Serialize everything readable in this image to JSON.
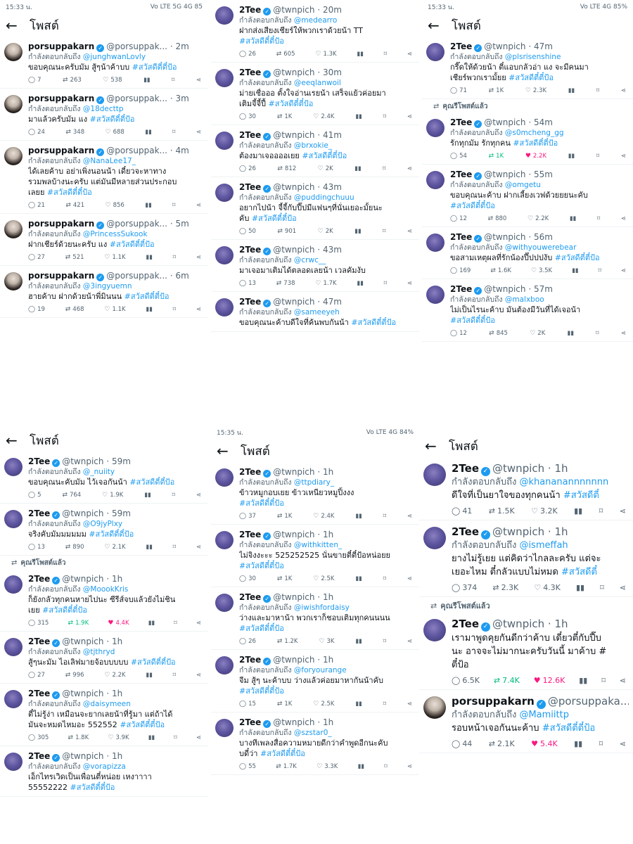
{
  "panels": [
    {
      "status": {
        "time": "15:33 น.",
        "right": "Vo LTE 5G 4G 85"
      },
      "title": "โพสต์",
      "tweets": [
        {
          "name": "porsuppakarn",
          "handle": "@porsuppak...",
          "time": "· 2m",
          "replying_to_label": "กำลังตอบกลับถึง",
          "mention": "@junghwanLovly",
          "text": "ขอบคุณนะครับมัม สู้ๆน้าค้าบบ ",
          "hashtag": "#สวัสดีตี๋ตี๋ป้อ",
          "replies": "7",
          "retweets": "263",
          "likes": "538",
          "views": "",
          "avatar": "porsuppakarn-avatar"
        },
        {
          "name": "porsuppakarn",
          "handle": "@porsuppak...",
          "time": "· 3m",
          "replying_to_label": "กำลังตอบกลับถึง",
          "mention": "@18decttp",
          "text": "มาแล้วครับมัม แง ",
          "hashtag": "#สวัสดีตี๋ตี๋ป้อ",
          "replies": "24",
          "retweets": "348",
          "likes": "688",
          "views": "",
          "avatar": "porsuppakarn-avatar"
        },
        {
          "name": "porsuppakarn",
          "handle": "@porsuppak...",
          "time": "· 4m",
          "replying_to_label": "กำลังตอบกลับถึง",
          "mention": "@NanaLee17_",
          "text": "ได้เลยค้าบ อย่าเพิ่งนอนน้า เดี๋ยวจะหาทาง\nรวมพลบ้างนะครับ แต่มันมีหลายส่วนประกอบ\nเลยย ",
          "hashtag": "#สวัสดีตี๋ตี๋ป้อ",
          "replies": "21",
          "retweets": "421",
          "likes": "856",
          "views": "",
          "avatar": "porsuppakarn-avatar"
        },
        {
          "name": "porsuppakarn",
          "handle": "@porsuppak...",
          "time": "· 5m",
          "replying_to_label": "กำลังตอบกลับถึง",
          "mention": "@PrincessSukook",
          "text": "ฝากเชียร์ด้วยนะครับ แง ",
          "hashtag": "#สวัสดีตี๋ตี๋ป้อ",
          "replies": "27",
          "retweets": "521",
          "likes": "1.1K",
          "views": "",
          "avatar": "porsuppakarn-avatar"
        },
        {
          "name": "porsuppakarn",
          "handle": "@porsuppak...",
          "time": "· 6m",
          "replying_to_label": "กำลังตอบกลับถึง",
          "mention": "@3ingyuemn",
          "text": "ฮายค้าบ ฝากด้วยน้าพี่มินนน ",
          "hashtag": "#สวัสดีตี๋ตี๋ป้อ",
          "replies": "19",
          "retweets": "468",
          "likes": "1.1K",
          "views": "",
          "avatar": "porsuppakarn-avatar"
        }
      ]
    },
    {
      "status": null,
      "title": "",
      "tweets": [
        {
          "name": "2Tee",
          "handle": "@twnpich",
          "time": "· 20m",
          "replying_to_label": "กำลังตอบกลับถึง",
          "mention": "@medearro",
          "text": "ฝากส่งเสียงเชียร์ให้พวกเราด้วยน้า TT\n",
          "hashtag": "#สวัสดีตี๋ตี๋ป้อ",
          "replies": "26",
          "retweets": "605",
          "likes": "1.3K",
          "views": "",
          "avatar": "2tee-avatar"
        },
        {
          "name": "2Tee",
          "handle": "@twnpich",
          "time": "· 30m",
          "replying_to_label": "กำลังตอบกลับถึง",
          "mention": "@eeqlanwoil",
          "text": "ม่ายเชื่อออ ตั้งใจอ่านเรยน้า เสร็จแย้วค่อยมา\nเติมจี้จี้ปี้ ",
          "hashtag": "#สวัสดีตี๋ตี๋ป้อ",
          "replies": "30",
          "retweets": "1K",
          "likes": "2.4K",
          "views": "",
          "avatar": "2tee-avatar"
        },
        {
          "name": "2Tee",
          "handle": "@twnpich",
          "time": "· 41m",
          "replying_to_label": "กำลังตอบกลับถึง",
          "mention": "@brxokie_",
          "text": "ต้องมาเจออออเยย ",
          "hashtag": "#สวัสดีตี๋ตี๋ป้อ",
          "replies": "26",
          "retweets": "812",
          "likes": "2K",
          "views": "",
          "avatar": "2tee-avatar"
        },
        {
          "name": "2Tee",
          "handle": "@twnpich",
          "time": "· 43m",
          "replying_to_label": "กำลังตอบกลับถึง",
          "mention": "@puddingchuuu",
          "text": "อยากไปน้า จี้จี้กับปี๊ปมีแฟนๆที่นั่นเยอะมั้ยนะ\nคับ ",
          "hashtag": "#สวัสดีตี๋ตี๋ป้อ",
          "replies": "50",
          "retweets": "901",
          "likes": "2K",
          "views": "",
          "avatar": "2tee-avatar"
        },
        {
          "name": "2Tee",
          "handle": "@twnpich",
          "time": "· 43m",
          "replying_to_label": "กำลังตอบกลับถึง",
          "mention": "@crwc__",
          "text": "มาเจอมาเติมได้ตลอดเลยน้า เวลคัมงับ",
          "hashtag": "",
          "replies": "13",
          "retweets": "738",
          "likes": "1.7K",
          "views": "",
          "avatar": "2tee-avatar"
        },
        {
          "name": "2Tee",
          "handle": "@twnpich",
          "time": "· 47m",
          "replying_to_label": "กำลังตอบกลับถึง",
          "mention": "@sameeyeh",
          "text": "ขอบคุณนะค้าบดีใจที่ค้นพบกันน้า ",
          "hashtag": "#สวัสดีตี๋ตี๋ป้อ",
          "replies": "",
          "retweets": "",
          "likes": "",
          "views": "",
          "avatar": "2tee-avatar"
        }
      ]
    },
    {
      "status": {
        "time": "15:33 น.",
        "right": "Vo LTE 4G 85%"
      },
      "title": "โพสต์",
      "tweets": [
        {
          "name": "2Tee",
          "handle": "@twnpich",
          "time": "· 47m",
          "replying_to_label": "กำลังตอบกลับถึง",
          "mention": "@plsrisenshine",
          "text": "กรี๊ดให้ด้วยน้า ตี๋แอบกลัวอ่า แง จะมีคนมา\nเชียร์พวกเรามั้ยย ",
          "hashtag": "#สวัสดีตี๋ตี๋ป้อ",
          "replies": "71",
          "retweets": "1K",
          "likes": "2.3K",
          "views": "",
          "avatar": "2tee-avatar"
        },
        {
          "retweet_label": "คุณรีโพสต์แล้ว",
          "name": "2Tee",
          "handle": "@twnpich",
          "time": "· 54m",
          "replying_to_label": "กำลังตอบกลับถึง",
          "mention": "@s0mcheng_gg",
          "text": "รักทุกมัม รักทุกคน ",
          "hashtag": "#สวัสดีตี๋ตี๋ป้อ",
          "replies": "54",
          "retweets": "1K",
          "likes": "2.2K",
          "views": "",
          "rt_on": true,
          "lk_on": true,
          "avatar": "2tee-avatar"
        },
        {
          "name": "2Tee",
          "handle": "@twnpich",
          "time": "· 55m",
          "replying_to_label": "กำลังตอบกลับถึง",
          "mention": "@omgetu",
          "text": "ขอบคุณนะค้าบ ฝากเลี้ยงเวฟด้วยยยนะคับ\n",
          "hashtag": "#สวัสดีตี๋ตี๋ป้อ",
          "replies": "12",
          "retweets": "880",
          "likes": "2.2K",
          "views": "",
          "avatar": "2tee-avatar"
        },
        {
          "name": "2Tee",
          "handle": "@twnpich",
          "time": "· 56m",
          "replying_to_label": "กำลังตอบกลับถึง",
          "mention": "@withyouwerebear",
          "text": "ขอสามเหตุผลที่รักน้องปี๊ปปปงับ ",
          "hashtag": "#สวัสดีตี๋ตี๋ป้อ",
          "replies": "169",
          "retweets": "1.6K",
          "likes": "3.5K",
          "views": "",
          "avatar": "2tee-avatar"
        },
        {
          "name": "2Tee",
          "handle": "@twnpich",
          "time": "· 57m",
          "replying_to_label": "กำลังตอบกลับถึง",
          "mention": "@malxboo",
          "text": "ไม่เป็นไรนะค้าบ มันต้องมีวันที่ได้เจอน้า\n",
          "hashtag": "#สวัสดีตี๋ตี๋ป้อ",
          "replies": "12",
          "retweets": "845",
          "likes": "2K",
          "views": "",
          "avatar": "2tee-avatar"
        }
      ]
    },
    {
      "status": null,
      "title": "โพสต์",
      "tweets": [
        {
          "name": "2Tee",
          "handle": "@twnpich",
          "time": "· 59m",
          "replying_to_label": "กำลังตอบกลับถึง",
          "mention": "@_nuiity",
          "text": "ขอบคุณนะคับมัม ไว้เจอกันน้า ",
          "hashtag": "#สวัสดีตี๋ตี๋ป้อ",
          "replies": "5",
          "retweets": "764",
          "likes": "1.9K",
          "views": "",
          "avatar": "2tee-avatar"
        },
        {
          "name": "2Tee",
          "handle": "@twnpich",
          "time": "· 59m",
          "replying_to_label": "กำลังตอบกลับถึง",
          "mention": "@O9jyPlxy",
          "text": "จริงคับมัมมมมมม ",
          "hashtag": "#สวัสดีตี๋ตี๋ป้อ",
          "replies": "13",
          "retweets": "890",
          "likes": "2.1K",
          "views": "",
          "avatar": "2tee-avatar"
        },
        {
          "retweet_label": "คุณรีโพสต์แล้ว",
          "name": "2Tee",
          "handle": "@twnpich",
          "time": "· 1h",
          "replying_to_label": "กำลังตอบกลับถึง",
          "mention": "@MoookKris",
          "text": "ก็ยังกลัวทุกคนหายไปนะ ซีรีส์จบแล้วยังไม่ชิน\nเยย ",
          "hashtag": "#สวัสดีตี๋ตี๋ป้อ",
          "replies": "315",
          "retweets": "1.9K",
          "likes": "4.4K",
          "views": "",
          "rt_on": true,
          "lk_on": true,
          "avatar": "2tee-avatar"
        },
        {
          "name": "2Tee",
          "handle": "@twnpich",
          "time": "· 1h",
          "replying_to_label": "กำลังตอบกลับถึง",
          "mention": "@tjthryd",
          "text": "สู้ๆนะมัม ไอเลิฟมายจ้อบบบบบ ",
          "hashtag": "#สวัสดีตี๋ตี๋ป้อ",
          "replies": "27",
          "retweets": "996",
          "likes": "2.2K",
          "views": "",
          "avatar": "2tee-avatar"
        },
        {
          "name": "2Tee",
          "handle": "@twnpich",
          "time": "· 1h",
          "replying_to_label": "กำลังตอบกลับถึง",
          "mention": "@daisymeen",
          "text": "ตี๋ไม่รู้ง่า เหมือนจะยากเลยน้าที่รู้มา แต่ถ้าได้\nมันจะหมดไหมอะ 552552 ",
          "hashtag": "#สวัสดีตี๋ตี๋ป้อ",
          "replies": "305",
          "retweets": "1.8K",
          "likes": "3.9K",
          "views": "",
          "avatar": "2tee-avatar"
        },
        {
          "name": "2Tee",
          "handle": "@twnpich",
          "time": "· 1h",
          "replying_to_label": "กำลังตอบกลับถึง",
          "mention": "@vorapizza",
          "text": "เอ็กไทรเวิดเป็นเพื่อนตี๋หน่อย เหงาาาา\n55552222 ",
          "hashtag": "#สวัสดีตี๋ตี๋ป้อ",
          "replies": "",
          "retweets": "",
          "likes": "",
          "views": "",
          "avatar": "2tee-avatar"
        }
      ]
    },
    {
      "status": {
        "time": "15:35 น.",
        "right": "Vo LTE 4G 84%"
      },
      "title": "โพสต์",
      "tweets": [
        {
          "name": "2Tee",
          "handle": "@twnpich",
          "time": "· 1h",
          "replying_to_label": "กำลังตอบกลับถึง",
          "mention": "@ttpdiary_",
          "text": "ข้าวหมูกอบเยย ข้าวเหนียวหมูปิ้งงง\n",
          "hashtag": "#สวัสดีตี๋ตี๋ป้อ",
          "replies": "37",
          "retweets": "1K",
          "likes": "2.4K",
          "views": "",
          "avatar": "2tee-avatar"
        },
        {
          "name": "2Tee",
          "handle": "@twnpich",
          "time": "· 1h",
          "replying_to_label": "กำลังตอบกลับถึง",
          "mention": "@withkitten_",
          "text": "ไม่จิงงะะะ 525252525 นั่นขายตี๋ตี๋ป้อหน่อยย\n",
          "hashtag": "#สวัสดีตี๋ตี๋ป้อ",
          "replies": "30",
          "retweets": "1K",
          "likes": "2.5K",
          "views": "",
          "avatar": "2tee-avatar"
        },
        {
          "name": "2Tee",
          "handle": "@twnpich",
          "time": "· 1h",
          "replying_to_label": "กำลังตอบกลับถึง",
          "mention": "@iwishfordaisy",
          "text": "ว่างและมาหาน้า พวกเราก็ชอบเติมทุกคนนนน\n",
          "hashtag": "#สวัสดีตี๋ตี๋ป้อ",
          "replies": "26",
          "retweets": "1.2K",
          "likes": "3K",
          "views": "",
          "avatar": "2tee-avatar"
        },
        {
          "name": "2Tee",
          "handle": "@twnpich",
          "time": "· 1h",
          "replying_to_label": "กำลังตอบกลับถึง",
          "mention": "@foryourange",
          "text": "จีม สู้ๆ นะค้าบบ ว่างแล้วค่อยมาหากันน้าคับ\n",
          "hashtag": "#สวัสดีตี๋ตี๋ป้อ",
          "replies": "15",
          "retweets": "1K",
          "likes": "2.5K",
          "views": "",
          "avatar": "2tee-avatar"
        },
        {
          "name": "2Tee",
          "handle": "@twnpich",
          "time": "· 1h",
          "replying_to_label": "กำลังตอบกลับถึง",
          "mention": "@szstar0_",
          "text": "บางทีเพลงสื่อความหมายดีกว่าคำพูดอีกนะคับ\nบดี๋ว่า ",
          "hashtag": "#สวัสดีตี๋ตี๋ป้อ",
          "replies": "55",
          "retweets": "1.7K",
          "likes": "3.3K",
          "views": "",
          "avatar": "2tee-avatar"
        }
      ]
    },
    {
      "status": null,
      "title": "โพสต์",
      "tweets": [
        {
          "name": "2Tee",
          "handle": "@twnpich",
          "time": "· 1h",
          "replying_to_label": "กำลังตอบกลับถึง",
          "mention": "@khananannnnnnn",
          "text": "ดีใจที่เป็นยาใจของทุกคนน้า ",
          "hashtag": "#สวัสดีตี๋",
          "replies": "41",
          "retweets": "1.5K",
          "likes": "3.2K",
          "views": "",
          "avatar": "2tee-avatar"
        },
        {
          "name": "2Tee",
          "handle": "@twnpich",
          "time": "· 1h",
          "replying_to_label": "กำลังตอบกลับถึง",
          "mention": "@ismeffah",
          "text": "ยางไม่รู้เยย แต่คิดว่าไกลละครับ แต่จะ\nเยอะไหม ตี๋กลัวแบบไม่หมด ",
          "hashtag": "#สวัสดีตี๋",
          "replies": "374",
          "retweets": "2.3K",
          "likes": "4.3K",
          "views": "",
          "avatar": "2tee-avatar"
        },
        {
          "retweet_label": "คุณรีโพสต์แล้ว",
          "name": "2Tee",
          "handle": "@twnpich",
          "time": "· 1h",
          "replying_to_label": "",
          "mention": "",
          "text": "เรามาพูดคุยกันดีกว่าค้าบ เดี๋ยวตี๋กับปี๊บ\nนะ อาจจะไม่มากนะครับวันนี้ มาค้าบ #\nตี๋ป้อ",
          "hashtag": "",
          "replies": "6.5K",
          "retweets": "7.4K",
          "likes": "12.6K",
          "views": "",
          "rt_on": true,
          "lk_on": true,
          "avatar": "2tee-avatar"
        },
        {
          "name": "porsuppakarn",
          "handle": "@porsuppaka...",
          "time": "",
          "replying_to_label": "กำลังตอบกลับถึง",
          "mention": "@Mamiittp",
          "text": "รอบหน้าเจอกันนะค้าบ ",
          "hashtag": "#สวัสดีตี๋ตี๋ป้อ",
          "replies": "44",
          "retweets": "2.1K",
          "likes": "5.4K",
          "views": "",
          "lk_on": true,
          "avatar": "porsuppakarn-avatar"
        }
      ]
    }
  ]
}
